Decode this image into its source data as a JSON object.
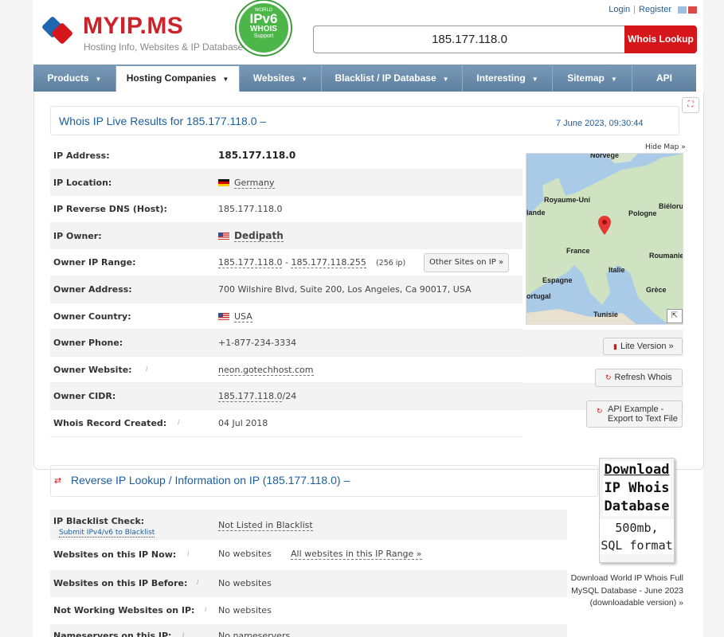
{
  "header": {
    "logo_text": "MYIP.MS",
    "logo_sub": "Hosting Info, Websites & IP Database",
    "badge": {
      "line1": "WORLD",
      "line2": "IPv6",
      "line3": "WHOIS",
      "line4": "Support"
    },
    "login": "Login",
    "separator": "|",
    "register": "Register",
    "search_value": "185.177.118.0",
    "search_button": "Whois Lookup"
  },
  "nav": [
    {
      "label": "Products",
      "caret": "▼"
    },
    {
      "label": "Hosting Companies",
      "caret": "▼"
    },
    {
      "label": "Websites",
      "caret": "▼"
    },
    {
      "label": "Blacklist / IP Database",
      "caret": "▼"
    },
    {
      "label": "Interesting",
      "caret": "▼"
    },
    {
      "label": "Sitemap",
      "caret": "▼"
    },
    {
      "label": "API",
      "caret": ""
    }
  ],
  "section1": {
    "title": "Whois IP Live Results for 185.177.118.0 –",
    "date": "7 June 2023, 09:30:44",
    "hide_map": "Hide Map »",
    "rows": [
      {
        "label": "IP Address:",
        "value": "185.177.118.0"
      },
      {
        "label": "IP Location:",
        "value": "Germany"
      },
      {
        "label": "IP Reverse DNS (Host):",
        "value": "185.177.118.0"
      },
      {
        "label": "IP Owner:",
        "value": "Dedipath"
      },
      {
        "label": "Owner IP Range:",
        "value_a": "185.177.118.0",
        "dash": " - ",
        "value_b": "185.177.118.255",
        "count": "(256 ip)",
        "button": "Other Sites on IP »"
      },
      {
        "label": "Owner Address:",
        "value": "700 Wilshire Blvd, Suite 200, Los Angeles, Ca 90017, USA"
      },
      {
        "label": "Owner Country:",
        "value": "USA"
      },
      {
        "label": "Owner Phone:",
        "value": "+1-877-234-3334"
      },
      {
        "label": "Owner Website:",
        "value": "neon.gotechhost.com"
      },
      {
        "label": "Owner CIDR:",
        "value_a": "185.177.118.0",
        "value_b": "/24"
      },
      {
        "label": "Whois Record Created:",
        "value": "04 Jul 2018"
      }
    ],
    "map_labels": [
      "Norvège",
      "Royaume-Uni",
      "lande",
      "Biélorus",
      "Pologne",
      "France",
      "Roumanie",
      "Italie",
      "Espagne",
      "ortugal",
      "Grèce",
      "Tunisie"
    ],
    "buttons": {
      "lite": "Lite Version »",
      "refresh": "Refresh Whois",
      "api_line1": "API Example -",
      "api_line2": "Export to Text File"
    }
  },
  "section2": {
    "title": "Reverse IP Lookup / Information on IP (185.177.118.0) –",
    "rows": [
      {
        "label": "IP Blacklist Check:",
        "sub": "Submit IPv4/v6 to Blacklist",
        "value": "Not Listed in Blacklist"
      },
      {
        "label": "Websites on this IP Now:",
        "value": "No websites",
        "link": "All websites in this IP Range »"
      },
      {
        "label": "Websites on this IP Before:",
        "value": "No websites"
      },
      {
        "label": "Not Working Websites on IP:",
        "value": "No websites"
      },
      {
        "label": "Nameservers on this IP:",
        "value": "No nameservers"
      }
    ],
    "download": {
      "l1": "Download",
      "l2": "IP Whois",
      "l3": "Database",
      "l4": "500mb,",
      "l5": "SQL format",
      "text": "Download World IP Whois Full MySQL Database - June 2023 (downloadable version) »"
    }
  },
  "colors": {
    "brand_red": "#d5161b",
    "link_blue": "#1b5e9e",
    "nav_blue": "#6c8dac",
    "badge_green": "#4cb648"
  }
}
